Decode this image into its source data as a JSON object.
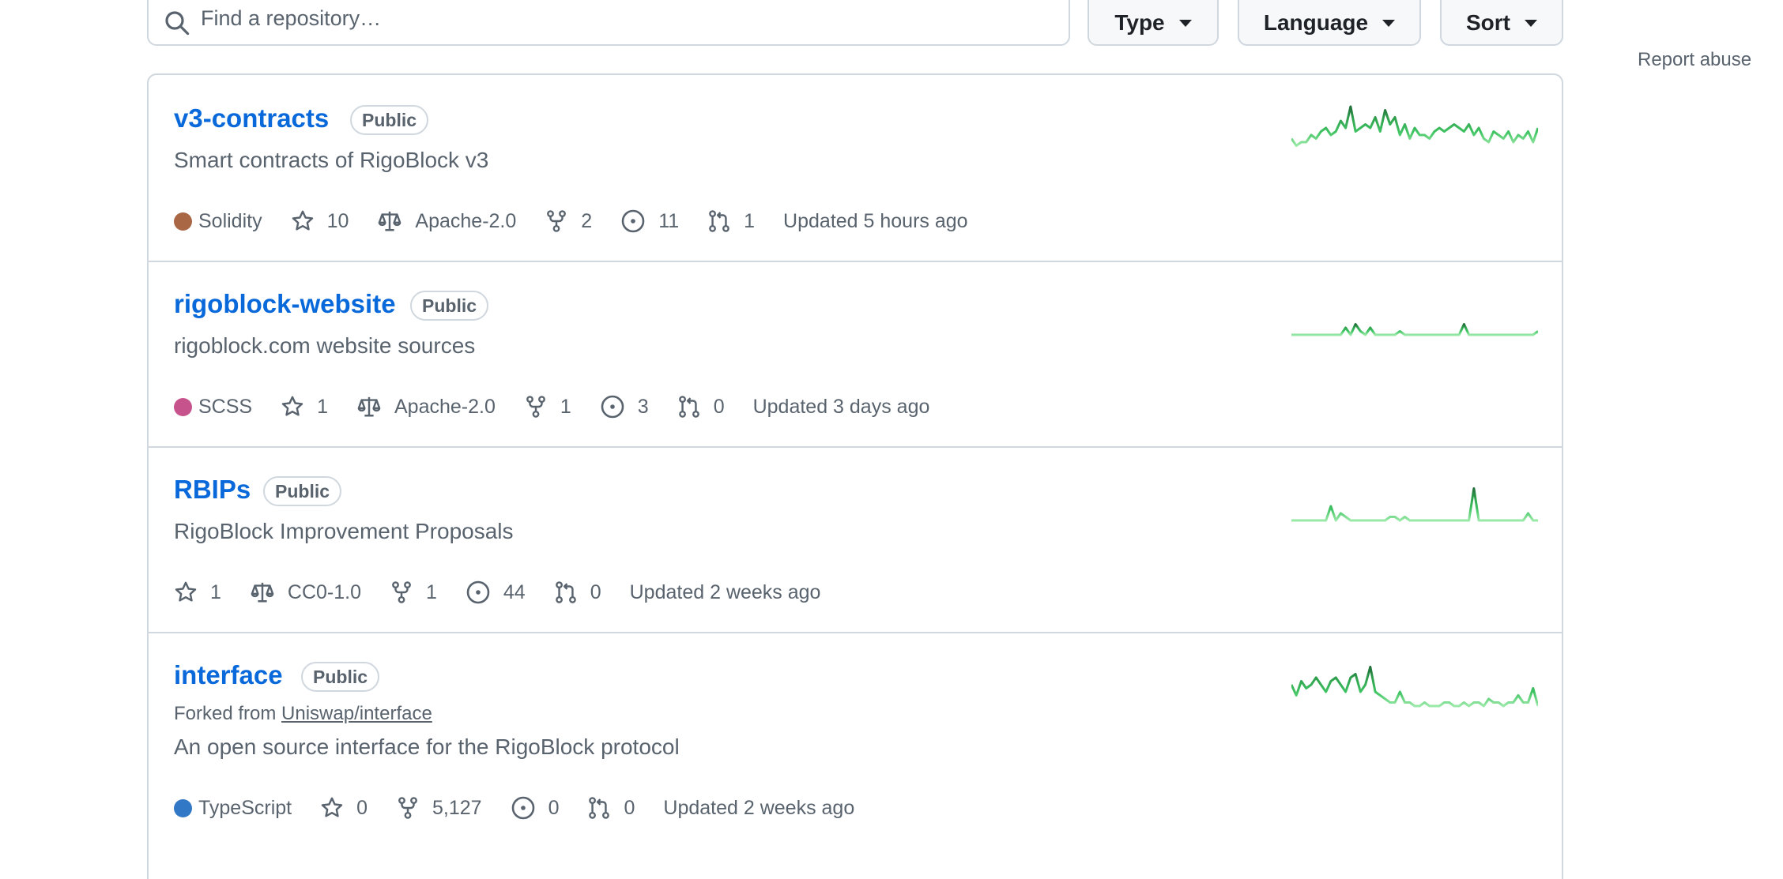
{
  "filters": {
    "search_placeholder": "Find a repository…",
    "type_label": "Type",
    "language_label": "Language",
    "sort_label": "Sort"
  },
  "sidebar": {
    "report_abuse": "Report abuse"
  },
  "repos": [
    {
      "name": "v3-contracts",
      "visibility": "Public",
      "description": "Smart contracts of RigoBlock v3",
      "language": "Solidity",
      "language_color": "#aa6746",
      "stars": "10",
      "license": "Apache-2.0",
      "forks": "2",
      "issues": "11",
      "pull_requests": "1",
      "updated": "Updated 5 hours ago",
      "activity": [
        3,
        1,
        2,
        2,
        4,
        3,
        5,
        6,
        4,
        5,
        8,
        6,
        12,
        5,
        6,
        7,
        6,
        9,
        5,
        11,
        7,
        9,
        4,
        7,
        3,
        6,
        4,
        4,
        3,
        5,
        6,
        5,
        6,
        7,
        6,
        5,
        7,
        4,
        6,
        3,
        2,
        5,
        4,
        3,
        5,
        2,
        4,
        3,
        5,
        2,
        6
      ]
    },
    {
      "name": "rigoblock-website",
      "visibility": "Public",
      "description": "rigoblock.com website sources",
      "language": "SCSS",
      "language_color": "#c6538c",
      "stars": "1",
      "license": "Apache-2.0",
      "forks": "1",
      "issues": "3",
      "pull_requests": "0",
      "updated": "Updated 3 days ago",
      "activity": [
        0,
        0,
        0,
        0,
        0,
        0,
        0,
        0,
        0,
        0,
        0,
        2,
        0,
        3,
        1,
        0,
        2,
        0,
        0,
        0,
        0,
        0,
        1,
        0,
        0,
        0,
        0,
        0,
        0,
        0,
        0,
        0,
        0,
        0,
        0,
        3,
        0,
        0,
        0,
        0,
        0,
        0,
        0,
        0,
        0,
        0,
        0,
        0,
        0,
        0,
        1
      ]
    },
    {
      "name": "RBIPs",
      "visibility": "Public",
      "description": "RigoBlock Improvement Proposals",
      "stars": "1",
      "license": "CC0-1.0",
      "forks": "1",
      "issues": "44",
      "pull_requests": "0",
      "updated": "Updated 2 weeks ago",
      "activity": [
        0,
        0,
        0,
        0,
        0,
        0,
        0,
        0,
        4,
        0,
        2,
        1,
        0,
        0,
        0,
        0,
        0,
        0,
        0,
        0,
        1,
        1,
        0,
        1,
        0,
        0,
        0,
        0,
        0,
        0,
        0,
        0,
        0,
        0,
        0,
        0,
        0,
        9,
        0,
        0,
        0,
        0,
        0,
        0,
        0,
        0,
        0,
        0,
        2,
        0,
        0
      ]
    },
    {
      "name": "interface",
      "visibility": "Public",
      "forked_label": "Forked from",
      "forked_from": "Uniswap/interface",
      "description": "An open source interface for the RigoBlock protocol",
      "language": "TypeScript",
      "language_color": "#3178c6",
      "stars": "0",
      "forks": "5,127",
      "issues": "0",
      "pull_requests": "0",
      "updated": "Updated 2 weeks ago",
      "activity": [
        6,
        3,
        7,
        5,
        6,
        8,
        6,
        4,
        7,
        8,
        6,
        4,
        8,
        9,
        4,
        6,
        11,
        4,
        3,
        2,
        1,
        1,
        4,
        1,
        1,
        0,
        0,
        1,
        0,
        0,
        0,
        1,
        1,
        0,
        0,
        1,
        0,
        1,
        1,
        0,
        2,
        1,
        1,
        0,
        1,
        1,
        3,
        1,
        1,
        5,
        0
      ]
    }
  ]
}
